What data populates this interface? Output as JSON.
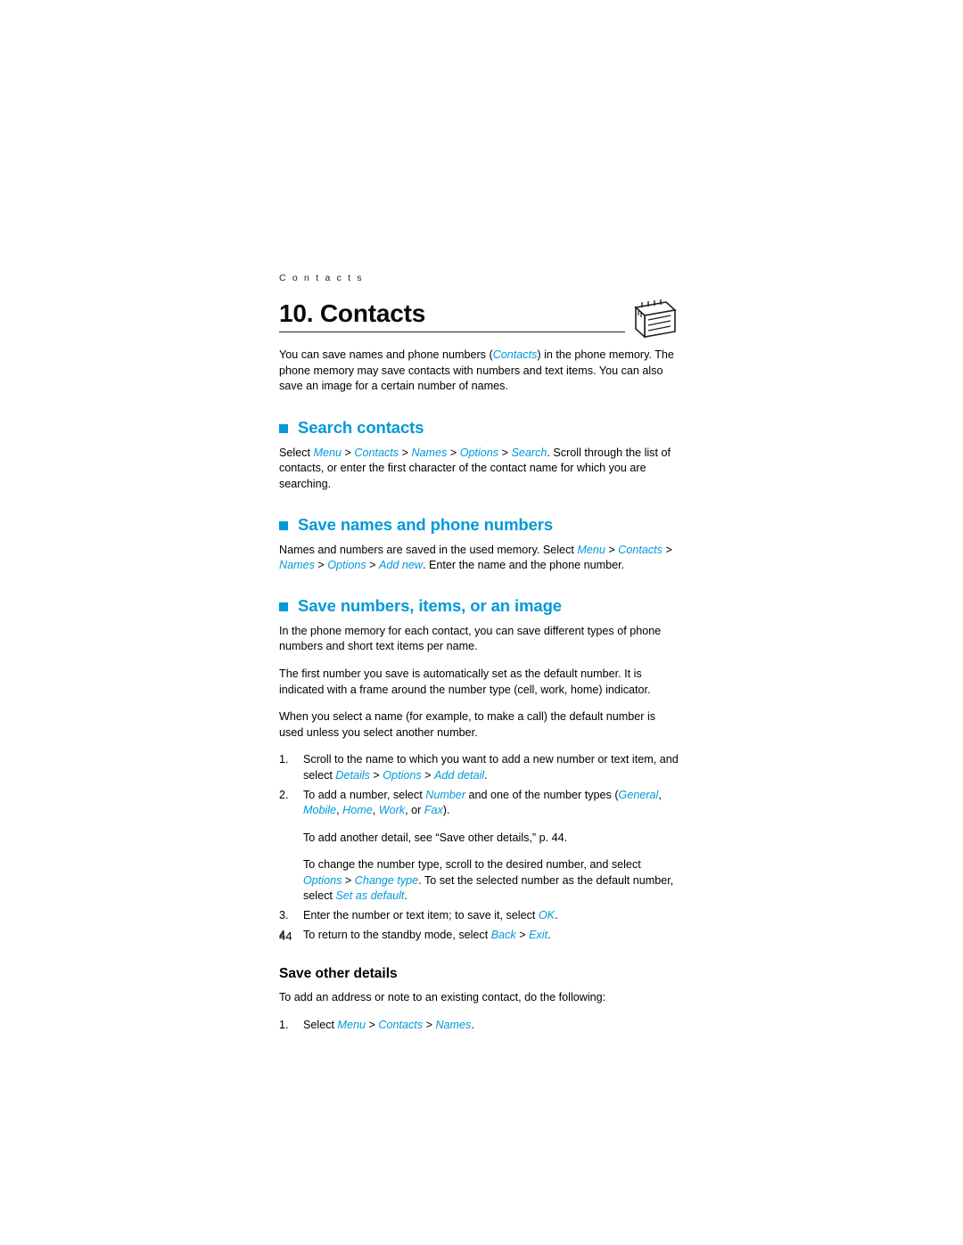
{
  "page": {
    "running_head": "C o n t a c t s",
    "chapter_title": "10. Contacts",
    "page_number": "44",
    "accent_color": "#0099d8",
    "icon_name": "notebook-icon"
  },
  "intro": {
    "line1_a": "You can save names and phone numbers (",
    "line1_em": "Contacts",
    "line1_b": ") in the phone memory. The phone memory may save contacts with numbers and text items. You can also save an image for a certain number of names."
  },
  "sections": [
    {
      "heading": "Search contacts",
      "body_a": "Select ",
      "t1": "Menu",
      "t2": "Contacts",
      "t3": "Names",
      "t4": "Options",
      "t5": "Search",
      "body_b": ". Scroll through the list of contacts, or enter the first character of the contact name for which you are searching."
    },
    {
      "heading": "Save names and phone numbers",
      "body_a": "Names and numbers are saved in the used memory. Select ",
      "t1": "Menu",
      "t2": "Contacts",
      "t3": "Names",
      "t4": "Options",
      "t5": "Add new",
      "body_b": ". Enter the name and the phone number."
    },
    {
      "heading": "Save numbers, items, or an image",
      "p1": "In the phone memory for each contact, you can save different types of phone numbers and short text items per name.",
      "p2": "The first number you save is automatically set as the default number. It is indicated with a frame around the number type (cell, work, home) indicator.",
      "p3": "When you select a name (for example, to make a call) the default number is used unless you select another number."
    }
  ],
  "steps": {
    "s1": {
      "num": "1.",
      "a": "Scroll to the name to which you want to add a new number or text item, and select ",
      "t1": "Details",
      "t2": "Options",
      "t3": "Add detail",
      "b": "."
    },
    "s2": {
      "num": "2.",
      "a": "To add a number, select ",
      "t1": "Number",
      "b": " and one of the number types (",
      "t2": "General",
      "t3": "Mobile",
      "t4": "Home",
      "t5": "Work",
      "c": ", or ",
      "t6": "Fax",
      "d": ").",
      "p_after1": "To add another detail, see “Save other details,” p. 44.",
      "p_after2_a": "To change the number type, scroll to the desired number, and select ",
      "t7": "Options",
      "p_after2_b": " > ",
      "t8": "Change type",
      "p_after2_c": ". To set the selected number as the default number, select ",
      "t9": "Set as default",
      "p_after2_d": "."
    },
    "s3": {
      "num": "3.",
      "a": "Enter the number or text item; to save it, select ",
      "t1": "OK",
      "b": "."
    },
    "s4": {
      "num": "4.",
      "a": "To return to the standby mode, select ",
      "t1": "Back",
      "mid": " > ",
      "t2": "Exit",
      "b": "."
    }
  },
  "save_other": {
    "heading": "Save other details",
    "intro": "To add an address or note to an existing contact, do the following:",
    "step1_num": "1.",
    "step1_a": "Select ",
    "t1": "Menu",
    "t2": "Contacts",
    "t3": "Names",
    "step1_b": "."
  },
  "separators": {
    "gt": " > "
  }
}
